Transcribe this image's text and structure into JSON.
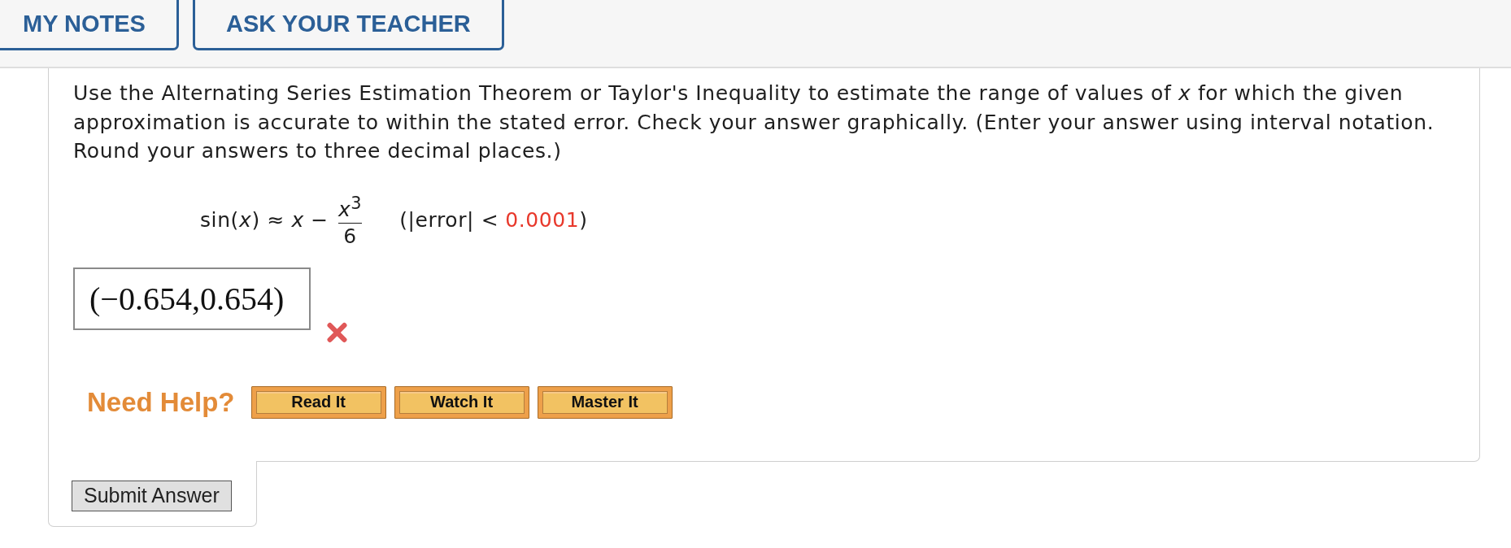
{
  "tabs": [
    {
      "label": "MY NOTES"
    },
    {
      "label": "ASK YOUR TEACHER"
    }
  ],
  "question": {
    "text": "Use the Alternating Series Estimation Theorem or Taylor's Inequality to estimate the range of values of *x* for which the given approximation is accurate to within the stated error. Check your answer graphically. (Enter your answer using interval notation. Round your answers to three decimal places.)",
    "formula": {
      "left": "sin(*x*) ≈ *x* −",
      "numerator": "*x*$^{3}$",
      "denominator": "6",
      "condition_open": "(|error| <",
      "bound": "0.0001",
      "condition_close": ")"
    }
  },
  "answer": {
    "value": "(−0.654,0.654)",
    "correct": false
  },
  "help": {
    "label": "Need Help?",
    "buttons": [
      "Read It",
      "Watch It",
      "Master It"
    ]
  },
  "submit": {
    "label": "Submit Answer"
  }
}
